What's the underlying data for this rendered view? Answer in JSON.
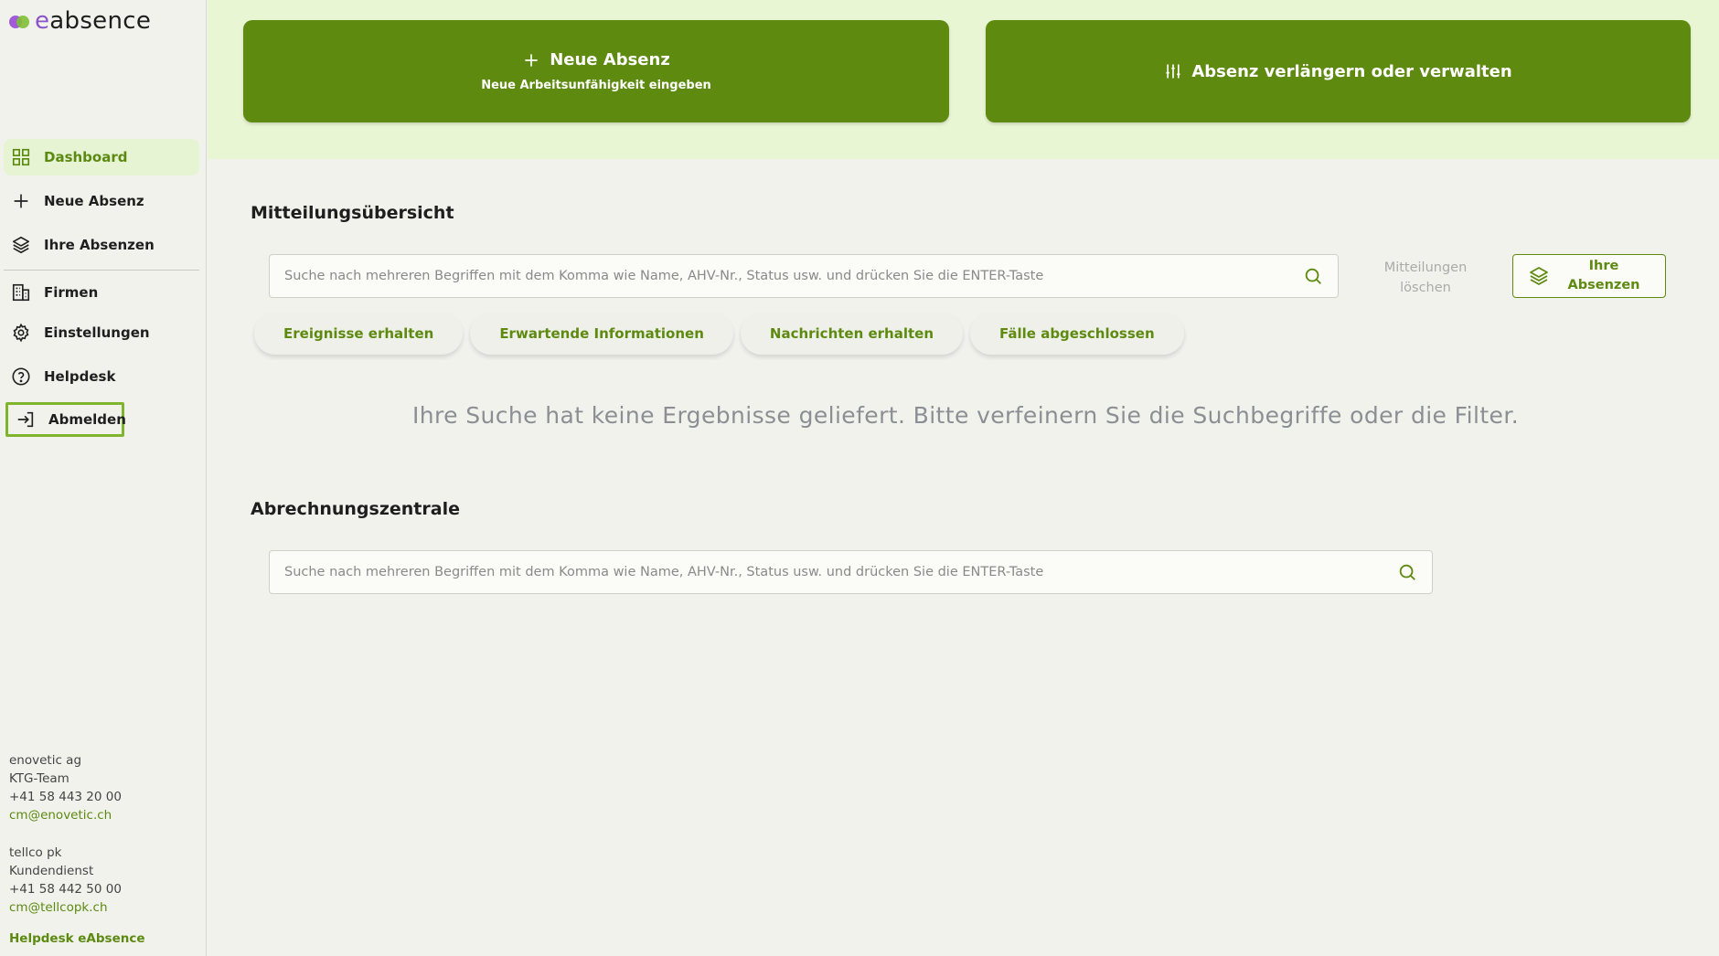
{
  "app": {
    "logo_prefix": "e",
    "logo_rest": "absence"
  },
  "sidebar": {
    "items": [
      {
        "label": "Dashboard"
      },
      {
        "label": "Neue Absenz"
      },
      {
        "label": "Ihre Absenzen"
      },
      {
        "label": "Firmen"
      },
      {
        "label": "Einstellungen"
      },
      {
        "label": "Helpdesk"
      },
      {
        "label": "Abmelden"
      }
    ]
  },
  "contacts": {
    "c1": {
      "company": "enovetic ag",
      "team": "KTG-Team",
      "phone": "+41 58 443 20 00",
      "email": "cm@enovetic.ch"
    },
    "c2": {
      "company": "tellco pk",
      "team": "Kundendienst",
      "phone": "+41 58 442 50 00",
      "email": "cm@tellcopk.ch"
    },
    "helpdesk": "Helpdesk eAbsence"
  },
  "actions": {
    "new_absence_title": "Neue Absenz",
    "new_absence_sub": "Neue Arbeitsunfähigkeit eingeben",
    "manage_title": "Absenz verlängern oder verwalten"
  },
  "messages": {
    "title": "Mitteilungsübersicht",
    "search_placeholder": "Suche nach mehreren Begriffen mit dem Komma wie Name, AHV-Nr., Status usw. und drücken Sie die ENTER-Taste",
    "delete_line1": "Mitteilungen",
    "delete_line2": "löschen",
    "your_absences_line1": "Ihre",
    "your_absences_line2": "Absenzen",
    "filters": [
      "Ereignisse erhalten",
      "Erwartende Informationen",
      "Nachrichten erhalten",
      "Fälle abgeschlossen"
    ],
    "empty_text": "Ihre Suche hat keine Ergebnisse geliefert. Bitte verfeinern Sie die Suchbegriffe oder die Filter."
  },
  "billing": {
    "title": "Abrechnungszentrale",
    "search_placeholder": "Suche nach mehreren Begriffen mit dem Komma wie Name, AHV-Nr., Status usw. und drücken Sie die ENTER-Taste"
  },
  "colors": {
    "accent": "#5e8a10",
    "band": "#e9f6d4",
    "active_bg": "#e6f4d4",
    "logo_purple": "#8a55c9"
  }
}
